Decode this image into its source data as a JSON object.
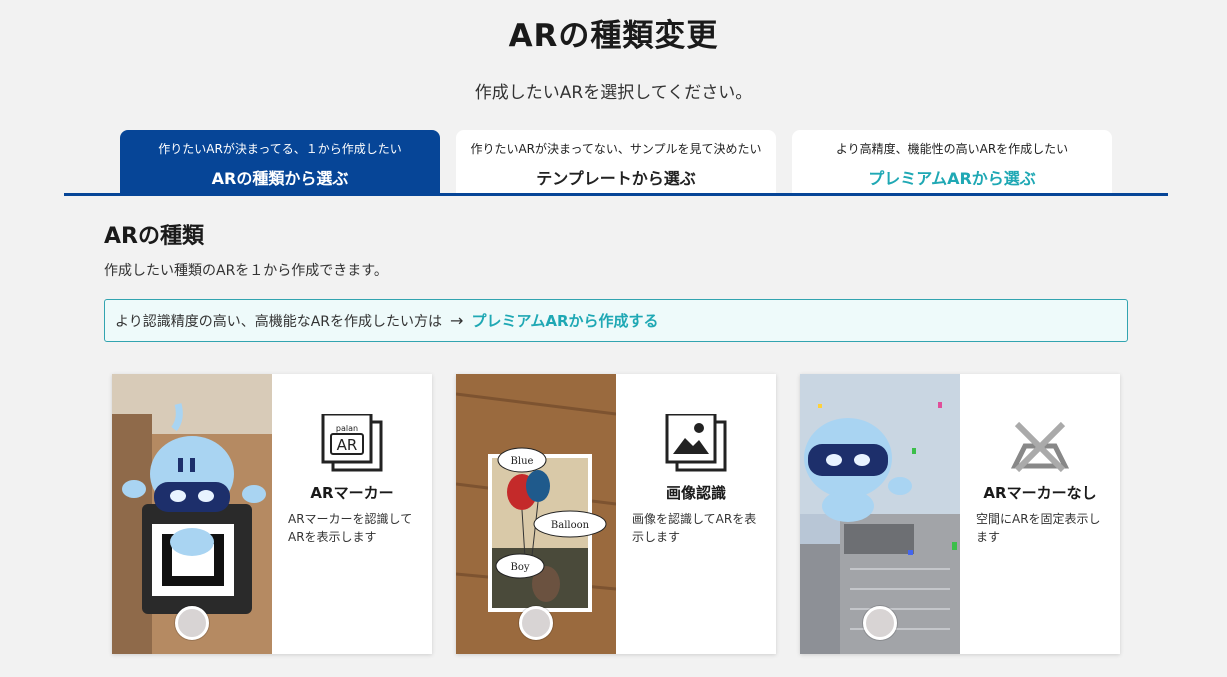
{
  "page": {
    "title": "ARの種類変更",
    "subtitle": "作成したいARを選択してください。"
  },
  "tabs": [
    {
      "small": "作りたいARが決まってる、１から作成したい",
      "big": "ARの種類から選ぶ",
      "active": true
    },
    {
      "small": "作りたいARが決まってない、サンプルを見て決めたい",
      "big": "テンプレートから選ぶ",
      "active": false
    },
    {
      "small": "より高精度、機能性の高いARを作成したい",
      "big": "プレミアムARから選ぶ",
      "active": false
    }
  ],
  "section": {
    "title": "ARの種類",
    "desc": "作成したい種類のARを１から作成できます。"
  },
  "notice": {
    "text": "より認識精度の高い、高機能なARを作成したい方は",
    "arrow": "→",
    "link": "プレミアムARから作成する"
  },
  "cards": [
    {
      "name": "ARマーカー",
      "desc": "ARマーカーを認識してARを表示します",
      "icon": "ar-marker-icon",
      "icon_text_top": "palan",
      "icon_text_main": "AR"
    },
    {
      "name": "画像認識",
      "desc": "画像を認識してARを表示します",
      "icon": "image-icon",
      "balloon_labels": [
        "Blue",
        "Balloon",
        "Boy"
      ]
    },
    {
      "name": "ARマーカーなし",
      "desc": "空間にARを固定表示します",
      "icon": "no-marker-icon"
    }
  ],
  "colors": {
    "primary": "#064597",
    "accent": "#1fa8b4",
    "background": "#f2f2f2"
  }
}
